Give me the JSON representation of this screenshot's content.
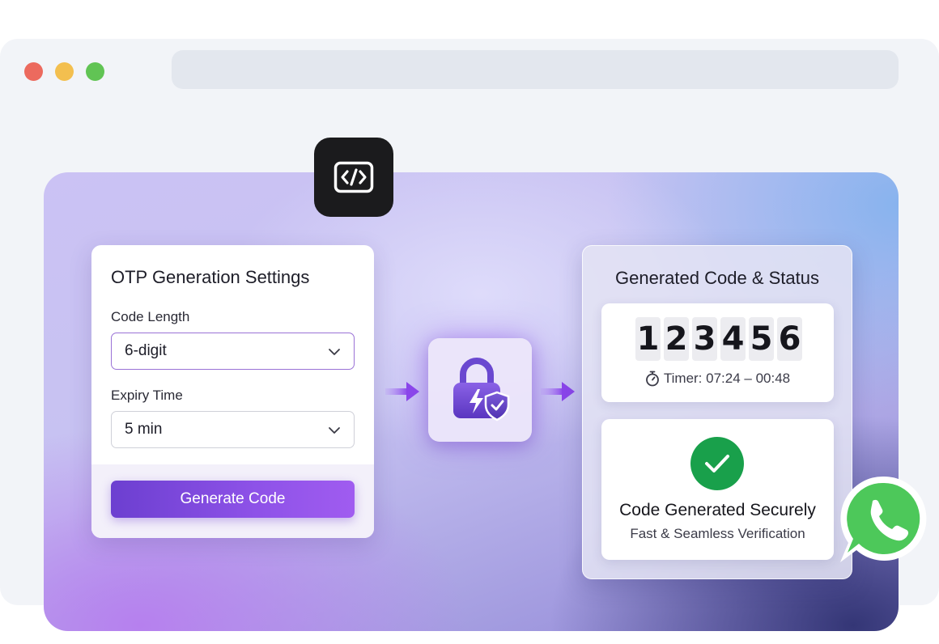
{
  "window": {
    "traffic_lights": [
      "#ec6a5e",
      "#f3bf4f",
      "#61c454"
    ]
  },
  "badge": {
    "icon": "code-icon"
  },
  "settings": {
    "title": "OTP Generation Settings",
    "code_length_label": "Code Length",
    "code_length_value": "6-digit",
    "expiry_label": "Expiry Time",
    "expiry_value": "5 min",
    "generate_label": "Generate Code"
  },
  "center": {
    "icon": "lock-shield-icon"
  },
  "result": {
    "title": "Generated Code & Status",
    "digits": [
      "1",
      "2",
      "3",
      "4",
      "5",
      "6"
    ],
    "timer": "Timer: 07:24 – 00:48",
    "status_title": "Code Generated Securely",
    "status_subtitle": "Fast & Seamless Verification"
  },
  "float_icon": "whatsapp-icon",
  "colors": {
    "accent": "#7c48e0",
    "success": "#19a04b",
    "whatsapp": "#4dc85a"
  }
}
